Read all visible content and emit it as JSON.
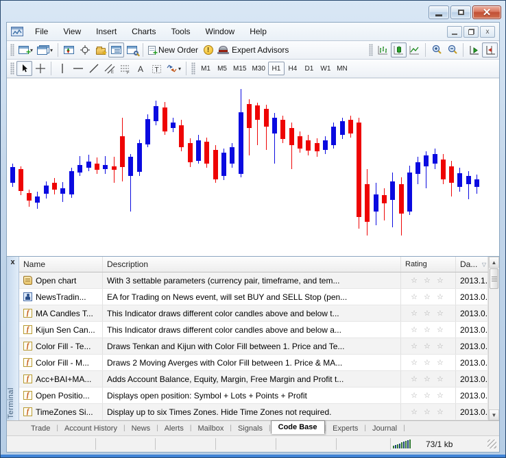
{
  "window": {
    "close": "✕"
  },
  "menu": {
    "items": [
      "File",
      "View",
      "Insert",
      "Charts",
      "Tools",
      "Window",
      "Help"
    ]
  },
  "toolbar": {
    "new_order_label": "New Order",
    "expert_advisors_label": "Expert Advisors"
  },
  "timeframes": {
    "items": [
      "M1",
      "M5",
      "M15",
      "M30",
      "H1",
      "H4",
      "D1",
      "W1",
      "MN"
    ],
    "active": "H1"
  },
  "chart": {
    "up_color": "#0a0ae0",
    "down_color": "#ee0404",
    "candles": [
      [
        5,
        122,
        127,
        150,
        156,
        "u"
      ],
      [
        17,
        126,
        130,
        162,
        168,
        "d"
      ],
      [
        29,
        160,
        165,
        176,
        185,
        "d"
      ],
      [
        41,
        163,
        170,
        179,
        188,
        "u"
      ],
      [
        54,
        148,
        154,
        166,
        173,
        "u"
      ],
      [
        66,
        143,
        150,
        160,
        167,
        "d"
      ],
      [
        78,
        149,
        158,
        166,
        178,
        "u"
      ],
      [
        91,
        128,
        133,
        167,
        172,
        "u"
      ],
      [
        103,
        111,
        124,
        135,
        140,
        "u"
      ],
      [
        116,
        109,
        119,
        128,
        133,
        "u"
      ],
      [
        128,
        113,
        122,
        131,
        137,
        "d"
      ],
      [
        140,
        111,
        124,
        130,
        137,
        "u"
      ],
      [
        153,
        112,
        126,
        131,
        150,
        "d"
      ],
      [
        165,
        55,
        82,
        127,
        148,
        "d"
      ],
      [
        177,
        108,
        112,
        140,
        192,
        "u"
      ],
      [
        190,
        87,
        92,
        134,
        140,
        "u"
      ],
      [
        202,
        50,
        57,
        94,
        98,
        "u"
      ],
      [
        214,
        30,
        38,
        60,
        66,
        "u"
      ],
      [
        227,
        32,
        40,
        75,
        80,
        "d"
      ],
      [
        239,
        55,
        62,
        70,
        76,
        "u"
      ],
      [
        251,
        58,
        66,
        98,
        104,
        "d"
      ],
      [
        264,
        85,
        92,
        120,
        127,
        "d"
      ],
      [
        276,
        80,
        88,
        118,
        122,
        "u"
      ],
      [
        288,
        84,
        90,
        122,
        128,
        "d"
      ],
      [
        301,
        95,
        102,
        145,
        150,
        "d"
      ],
      [
        313,
        100,
        106,
        140,
        146,
        "u"
      ],
      [
        325,
        92,
        98,
        122,
        128,
        "u"
      ],
      [
        338,
        13,
        47,
        137,
        142,
        "u"
      ],
      [
        350,
        28,
        35,
        70,
        110,
        "d"
      ],
      [
        362,
        33,
        37,
        58,
        95,
        "d"
      ],
      [
        375,
        36,
        42,
        68,
        102,
        "d"
      ],
      [
        387,
        48,
        55,
        78,
        122,
        "u"
      ],
      [
        399,
        52,
        58,
        86,
        92,
        "d"
      ],
      [
        412,
        62,
        70,
        95,
        130,
        "d"
      ],
      [
        424,
        75,
        82,
        100,
        106,
        "d"
      ],
      [
        436,
        80,
        88,
        103,
        110,
        "d"
      ],
      [
        449,
        85,
        92,
        104,
        112,
        "d"
      ],
      [
        461,
        82,
        88,
        102,
        108,
        "u"
      ],
      [
        473,
        62,
        68,
        95,
        100,
        "u"
      ],
      [
        486,
        55,
        60,
        80,
        86,
        "u"
      ],
      [
        498,
        52,
        58,
        78,
        84,
        "d"
      ],
      [
        510,
        55,
        62,
        200,
        217,
        "d"
      ],
      [
        522,
        130,
        152,
        207,
        227,
        "d"
      ],
      [
        535,
        150,
        167,
        192,
        212,
        "u"
      ],
      [
        547,
        158,
        168,
        180,
        205,
        "d"
      ],
      [
        559,
        135,
        148,
        175,
        215,
        "u"
      ],
      [
        572,
        142,
        152,
        195,
        227,
        "d"
      ],
      [
        584,
        125,
        135,
        192,
        197,
        "u"
      ],
      [
        596,
        112,
        120,
        137,
        152,
        "u"
      ],
      [
        608,
        104,
        110,
        126,
        158,
        "u"
      ],
      [
        621,
        100,
        108,
        122,
        130,
        "u"
      ],
      [
        633,
        108,
        116,
        145,
        152,
        "d"
      ],
      [
        645,
        118,
        126,
        150,
        170,
        "d"
      ],
      [
        657,
        128,
        136,
        156,
        163,
        "u"
      ],
      [
        670,
        133,
        140,
        152,
        174,
        "u"
      ],
      [
        682,
        138,
        145,
        156,
        166,
        "u"
      ]
    ]
  },
  "terminal": {
    "panel_label": "Terminal",
    "close_label": "x",
    "columns": [
      {
        "label": "Name"
      },
      {
        "label": "Description"
      },
      {
        "label": "Rating"
      },
      {
        "label": "Da...",
        "sort": "▽"
      }
    ],
    "rating_glyphs": "☆ ☆ ☆",
    "rows": [
      {
        "icon": "script",
        "name": "Open chart",
        "desc": "With 3 settable parameters (currency pair, timeframe, and tem...",
        "date": "2013.1..."
      },
      {
        "icon": "expert",
        "name": "NewsTradin...",
        "desc": "EA for Trading on News event, will set BUY and SELL Stop (pen...",
        "date": "2013.0..."
      },
      {
        "icon": "indicator",
        "name": "MA Candles T...",
        "desc": "This Indicator draws different color candles above and below t...",
        "date": "2013.0..."
      },
      {
        "icon": "indicator",
        "name": "Kijun Sen Can...",
        "desc": "This Indicator draws different color candles above and below a...",
        "date": "2013.0..."
      },
      {
        "icon": "indicator",
        "name": "Color Fill - Te...",
        "desc": "Draws Tenkan and Kijun with Color Fill between 1. Price and Te...",
        "date": "2013.0..."
      },
      {
        "icon": "indicator",
        "name": "Color Fill - M...",
        "desc": "Draws 2 Moving Averges with Color Fill between 1. Price & MA...",
        "date": "2013.0..."
      },
      {
        "icon": "indicator",
        "name": "Acc+BAI+MA...",
        "desc": "Adds Account Balance, Equity, Margin, Free Margin and Profit t...",
        "date": "2013.0..."
      },
      {
        "icon": "indicator",
        "name": "Open Positio...",
        "desc": "Displays open position: Symbol + Lots + Points + Profit",
        "date": "2013.0..."
      },
      {
        "icon": "indicator",
        "name": "TimeZones Si...",
        "desc": "Display up to six Times Zones. Hide Time Zones not required.",
        "date": "2013.0..."
      }
    ],
    "tabs": [
      "Trade",
      "Account History",
      "News",
      "Alerts",
      "Mailbox",
      "Signals",
      "Code Base",
      "Experts",
      "Journal"
    ],
    "active_tab": "Code Base"
  },
  "statusbar": {
    "connection": "73/1 kb"
  },
  "indicator_icon_glyph": "f"
}
